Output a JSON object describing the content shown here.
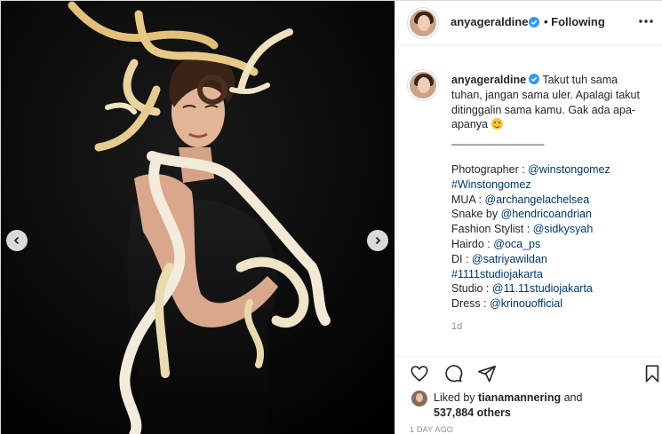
{
  "post": {
    "author": {
      "username": "anyageraldine",
      "verified": true
    },
    "follow_status": "• Following",
    "more_icon": "more-horizontal-icon",
    "caption": {
      "lines": [
        "Takut tuh sama",
        "tuhan, jangan sama uler. Apalagi takut",
        "ditinggalin sama kamu. Gak ada apa-",
        "apanya"
      ],
      "emoji": "grinning-sweat-emoji",
      "divider": "_______________",
      "credits": [
        {
          "label": "Photographer : ",
          "mention": "@winstongomez"
        },
        {
          "label": "",
          "mention": "#Winstongomez"
        },
        {
          "label": "MUA : ",
          "mention": "@archangelachelsea"
        },
        {
          "label": "Snake by ",
          "mention": "@hendricoandrian"
        },
        {
          "label": "Fashion Stylist : ",
          "mention": "@sidkysyah"
        },
        {
          "label": "Hairdo : ",
          "mention": "@oca_ps"
        },
        {
          "label": "DI : ",
          "mention": "@satriyawildan"
        },
        {
          "label": "",
          "mention": "#1111studiojakarta"
        },
        {
          "label": "Studio : ",
          "mention": "@11.11studiojakarta"
        },
        {
          "label": "Dress : ",
          "mention": "@krinouofficial"
        }
      ]
    },
    "comment_time": "1d",
    "likes": {
      "prefix": "Liked by ",
      "liker": "tianamannering",
      "suffix": " and",
      "others": "537,884 others"
    },
    "post_date": "1 DAY AGO"
  },
  "icons": {
    "like": "heart-icon",
    "comment": "comment-icon",
    "share": "paper-plane-icon",
    "save": "bookmark-icon",
    "prev": "chevron-left-icon",
    "next": "chevron-right-icon"
  },
  "colors": {
    "link": "#00376b",
    "verified_badge": "#3897f0",
    "muted": "#8e8e8e",
    "text": "#262626"
  }
}
